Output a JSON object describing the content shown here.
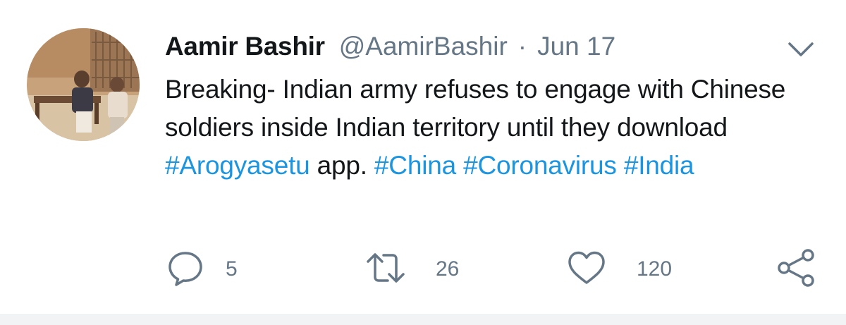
{
  "tweet": {
    "author_name": "Aamir Bashir",
    "author_handle": "@AamirBashir",
    "separator": "·",
    "date": "Jun 17",
    "text_parts": [
      "Breaking- Indian army refuses to engage with Chinese soldiers inside Indian territory until they download ",
      "#Arogyasetu",
      " app. ",
      "#China",
      " ",
      "#Coronavirus",
      " ",
      "#India"
    ],
    "hashtag_color": "#1b95e0"
  },
  "actions": {
    "reply_count": "5",
    "retweet_count": "26",
    "like_count": "120",
    "icons": [
      "reply-icon",
      "retweet-icon",
      "like-icon",
      "share-icon"
    ]
  },
  "colors": {
    "text": "#14171a",
    "secondary": "#657786",
    "background": "#ffffff"
  }
}
